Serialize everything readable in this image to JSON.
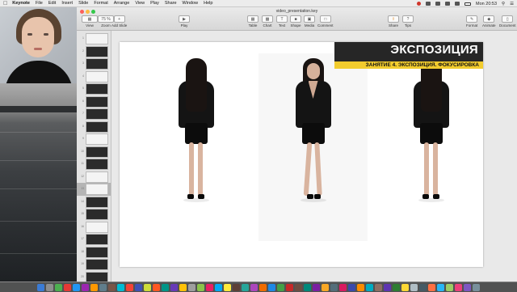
{
  "menubar": {
    "app": "Keynote",
    "items": [
      "File",
      "Edit",
      "Insert",
      "Slide",
      "Format",
      "Arrange",
      "View",
      "Play",
      "Share",
      "Window",
      "Help"
    ],
    "clock": "Mon 20:53"
  },
  "window": {
    "doc_title": "video_presentation.key",
    "toolbar": {
      "view": "View",
      "zoom": "Zoom",
      "zoom_value": "75 %",
      "add_slide": "Add Slide",
      "play": "Play",
      "table": "Table",
      "chart": "Chart",
      "text": "Text",
      "shape": "Shape",
      "media": "Media",
      "comment": "Comment",
      "share": "Share",
      "tips": "Tips",
      "format": "Format",
      "animate": "Animate",
      "document": "Document"
    }
  },
  "navigator": {
    "selected_index": 12,
    "slides": [
      {
        "num": "1",
        "style": "light"
      },
      {
        "num": "2",
        "style": "dark"
      },
      {
        "num": "3",
        "style": "dark"
      },
      {
        "num": "4",
        "style": "light"
      },
      {
        "num": "5",
        "style": "dark"
      },
      {
        "num": "6",
        "style": "dark"
      },
      {
        "num": "7",
        "style": "dark"
      },
      {
        "num": "8",
        "style": "dark"
      },
      {
        "num": "9",
        "style": "light"
      },
      {
        "num": "10",
        "style": "dark"
      },
      {
        "num": "11",
        "style": "dark"
      },
      {
        "num": "12",
        "style": "light"
      },
      {
        "num": "13",
        "style": "light"
      },
      {
        "num": "14",
        "style": "dark"
      },
      {
        "num": "15",
        "style": "dark"
      },
      {
        "num": "16",
        "style": "light"
      },
      {
        "num": "17",
        "style": "dark"
      },
      {
        "num": "18",
        "style": "dark"
      },
      {
        "num": "19",
        "style": "dark"
      },
      {
        "num": "20",
        "style": "dark"
      }
    ]
  },
  "slide": {
    "title": "ЭКСПОЗИЦИЯ",
    "subtitle": "ЗАНЯТИЕ 4. ЭКСПОЗИЦИЯ. ФОКУСИРОВКА"
  },
  "colors": {
    "banner_dark": "#262626",
    "banner_yellow": "#f2cc2e",
    "close": "#fc605b",
    "minimize": "#fdbc40",
    "zoom": "#34c84a"
  }
}
